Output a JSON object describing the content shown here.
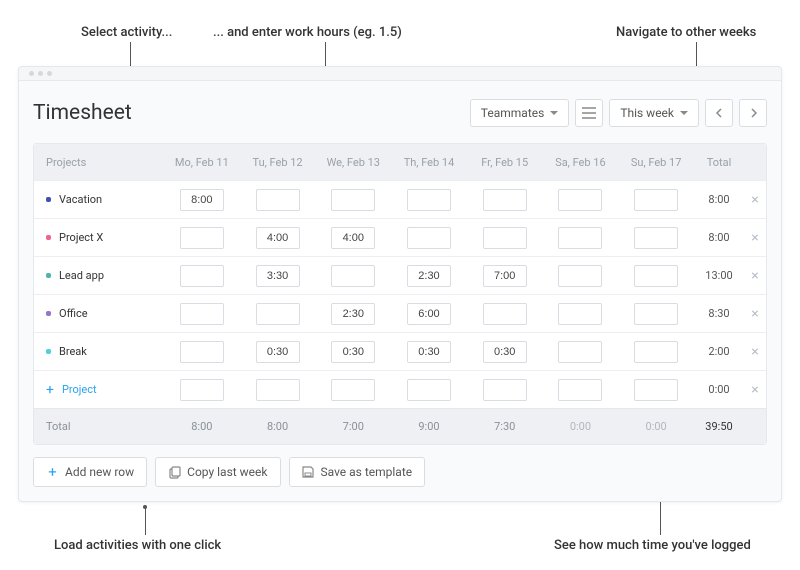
{
  "annotations": {
    "a1": "Select activity...",
    "a2": "... and enter work hours (eg. 1.5)",
    "a3": "Navigate to other weeks",
    "a4": "Load activities with one click",
    "a5": "See how much time you've logged"
  },
  "header": {
    "title": "Timesheet",
    "teammates": "Teammates",
    "thisweek": "This week"
  },
  "columns": [
    "Projects",
    "Mo, Feb 11",
    "Tu, Feb 12",
    "We, Feb 13",
    "Th, Feb 14",
    "Fr, Feb 15",
    "Sa, Feb 16",
    "Su, Feb 17",
    "Total"
  ],
  "rows": [
    {
      "name": "Vacation",
      "color": "#3f51b5",
      "cells": [
        "8:00",
        "",
        "",
        "",
        "",
        "",
        ""
      ],
      "total": "8:00"
    },
    {
      "name": "Project X",
      "color": "#f06292",
      "cells": [
        "",
        "4:00",
        "4:00",
        "",
        "",
        "",
        ""
      ],
      "total": "8:00"
    },
    {
      "name": "Lead app",
      "color": "#4db6ac",
      "cells": [
        "",
        "3:30",
        "",
        "2:30",
        "7:00",
        "",
        ""
      ],
      "total": "13:00"
    },
    {
      "name": "Office",
      "color": "#9575cd",
      "cells": [
        "",
        "",
        "2:30",
        "6:00",
        "",
        "",
        ""
      ],
      "total": "8:30"
    },
    {
      "name": "Break",
      "color": "#4dd0e1",
      "cells": [
        "",
        "0:30",
        "0:30",
        "0:30",
        "0:30",
        "",
        ""
      ],
      "total": "2:00"
    }
  ],
  "addRow": {
    "label": "Project",
    "total": "0:00"
  },
  "totals": {
    "label": "Total",
    "cells": [
      "8:00",
      "8:00",
      "7:00",
      "9:00",
      "7:30",
      "0:00",
      "0:00"
    ],
    "grand": "39:50"
  },
  "footer": {
    "add": "Add new row",
    "copy": "Copy last week",
    "save": "Save as template"
  }
}
